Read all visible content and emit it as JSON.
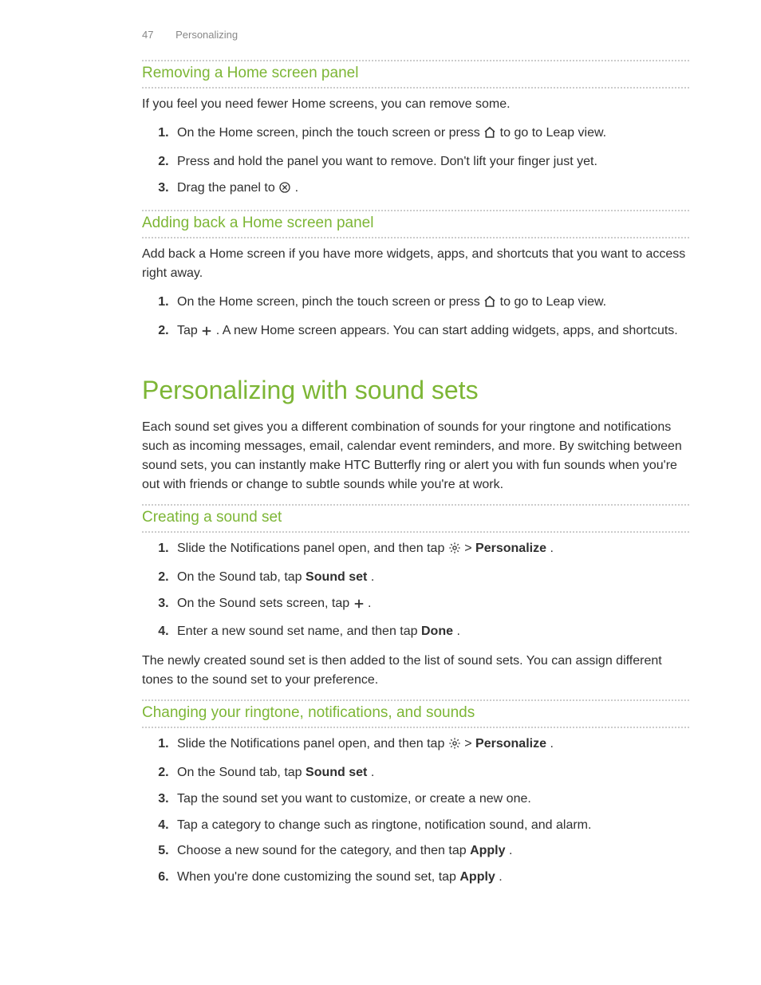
{
  "header": {
    "page_number": "47",
    "section": "Personalizing"
  },
  "removing": {
    "title": "Removing a Home screen panel",
    "intro": "If you feel you need fewer Home screens, you can remove some.",
    "step1_pre": "On the Home screen, pinch the touch screen or press ",
    "step1_post": " to go to Leap view.",
    "step2": "Press and hold the panel you want to remove. Don't lift your finger just yet.",
    "step3_pre": "Drag the panel to ",
    "step3_post": "."
  },
  "adding": {
    "title": "Adding back a Home screen panel",
    "intro": "Add back a Home screen if you have more widgets, apps, and shortcuts that you want to access right away.",
    "step1_pre": "On the Home screen, pinch the touch screen or press ",
    "step1_post": " to go to Leap view.",
    "step2_pre": "Tap ",
    "step2_post": ". A new Home screen appears. You can start adding widgets, apps, and shortcuts."
  },
  "sound_sets": {
    "title": "Personalizing with sound sets",
    "intro": "Each sound set gives you a different combination of sounds for your ringtone and notifications such as incoming messages, email, calendar event reminders, and more. By switching between sound sets, you can instantly make HTC Butterfly ring or alert you with fun sounds when you're out with friends or change to subtle sounds while you're at work."
  },
  "creating": {
    "title": "Creating a sound set",
    "step1_pre": "Slide the Notifications panel open, and then tap ",
    "step1_mid": " > ",
    "step1_bold": "Personalize",
    "step1_post": ".",
    "step2_pre": "On the Sound tab, tap ",
    "step2_bold": "Sound set",
    "step2_post": ".",
    "step3_pre": "On the Sound sets screen, tap ",
    "step3_post": ".",
    "step4_pre": "Enter a new sound set name, and then tap ",
    "step4_bold": "Done",
    "step4_post": ".",
    "after": "The newly created sound set is then added to the list of sound sets. You can assign different tones to the sound set to your preference."
  },
  "changing": {
    "title": "Changing your ringtone, notifications, and sounds",
    "step1_pre": "Slide the Notifications panel open, and then tap ",
    "step1_mid": " > ",
    "step1_bold": "Personalize",
    "step1_post": ".",
    "step2_pre": "On the Sound tab, tap ",
    "step2_bold": "Sound set",
    "step2_post": ".",
    "step3": "Tap the sound set you want to customize, or create a new one.",
    "step4": "Tap a category to change such as ringtone, notification sound, and alarm.",
    "step5_pre": "Choose a new sound for the category, and then tap ",
    "step5_bold": "Apply",
    "step5_post": ".",
    "step6_pre": "When you're done customizing the sound set, tap ",
    "step6_bold": "Apply",
    "step6_post": "."
  }
}
